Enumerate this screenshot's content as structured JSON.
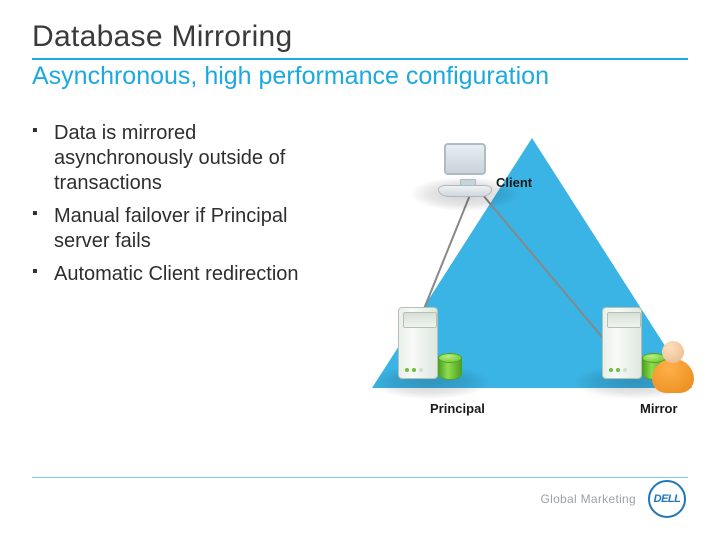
{
  "title": "Database Mirroring",
  "subtitle": "Asynchronous, high performance configuration",
  "bullets": [
    "Data is mirrored asynchronously outside of transactions",
    "Manual failover if Principal server fails",
    "Automatic Client redirection"
  ],
  "diagram": {
    "client_label": "Client",
    "principal_label": "Principal",
    "mirror_label": "Mirror"
  },
  "footer": {
    "text": "Global Marketing",
    "logo_text": "DELL"
  }
}
